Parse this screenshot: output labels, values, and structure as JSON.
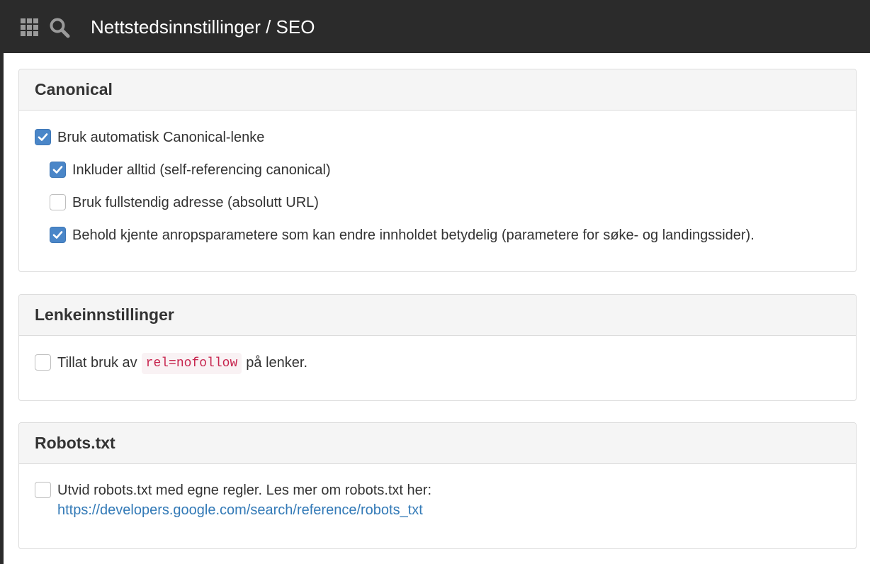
{
  "header": {
    "title": "Nettstedsinnstillinger / SEO"
  },
  "icons": {
    "apps": "grid-icon",
    "search": "search-icon",
    "check": "check-icon"
  },
  "colors": {
    "checkbox_checked": "#4a86c8",
    "link": "#337ab7",
    "code_text": "#c7254e",
    "code_bg": "#f9f2f4"
  },
  "canonical": {
    "title": "Canonical",
    "options": [
      {
        "label": "Bruk automatisk Canonical-lenke",
        "checked": true
      },
      {
        "label": "Inkluder alltid (self-referencing canonical)",
        "checked": true
      },
      {
        "label": "Bruk fullstendig adresse (absolutt URL)",
        "checked": false
      },
      {
        "label": "Behold kjente anropsparametere som kan endre innholdet betydelig (parametere for søke- og landingssider).",
        "checked": true
      }
    ]
  },
  "links": {
    "title": "Lenkeinnstillinger",
    "option": {
      "prefix": "Tillat bruk av",
      "code": "rel=nofollow",
      "suffix": "på lenker.",
      "checked": false
    }
  },
  "robots": {
    "title": "Robots.txt",
    "option": {
      "label": "Utvid robots.txt med egne regler. Les mer om robots.txt her:",
      "url": "https://developers.google.com/search/reference/robots_txt",
      "checked": false
    }
  }
}
